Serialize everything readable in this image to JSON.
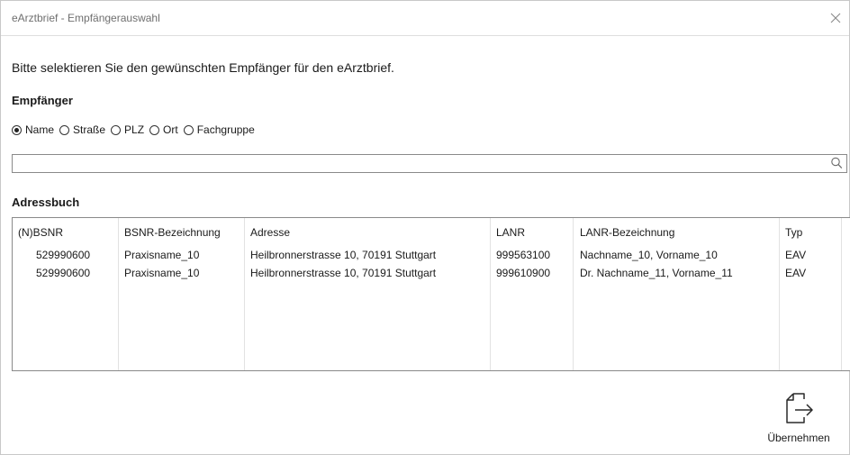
{
  "window": {
    "title": "eArztbrief - Empfängerauswahl"
  },
  "instruction": "Bitte selektieren Sie den gewünschten Empfänger für den eArztbrief.",
  "recipient_section": {
    "label": "Empfänger",
    "radios": [
      {
        "label": "Name",
        "checked": true
      },
      {
        "label": "Straße",
        "checked": false
      },
      {
        "label": "PLZ",
        "checked": false
      },
      {
        "label": "Ort",
        "checked": false
      },
      {
        "label": "Fachgruppe",
        "checked": false
      }
    ],
    "search": {
      "value": "",
      "placeholder": ""
    }
  },
  "addressbook": {
    "label": "Adressbuch",
    "columns": [
      "(N)BSNR",
      "BSNR-Bezeichnung",
      "Adresse",
      "LANR",
      "LANR-Bezeichnung",
      "Typ"
    ],
    "rows": [
      [
        "529990600",
        "Praxisname_10",
        "Heilbronnerstrasse 10, 70191 Stuttgart",
        "999563100",
        "Nachname_10, Vorname_10",
        "EAV"
      ],
      [
        "529990600",
        "Praxisname_10",
        "Heilbronnerstrasse 10, 70191 Stuttgart",
        "999610900",
        "Dr. Nachname_11, Vorname_11",
        "EAV"
      ]
    ]
  },
  "actions": {
    "accept_label": "Übernehmen"
  },
  "icons": {
    "close": "close-icon",
    "search": "search-icon",
    "accept": "export-icon"
  }
}
